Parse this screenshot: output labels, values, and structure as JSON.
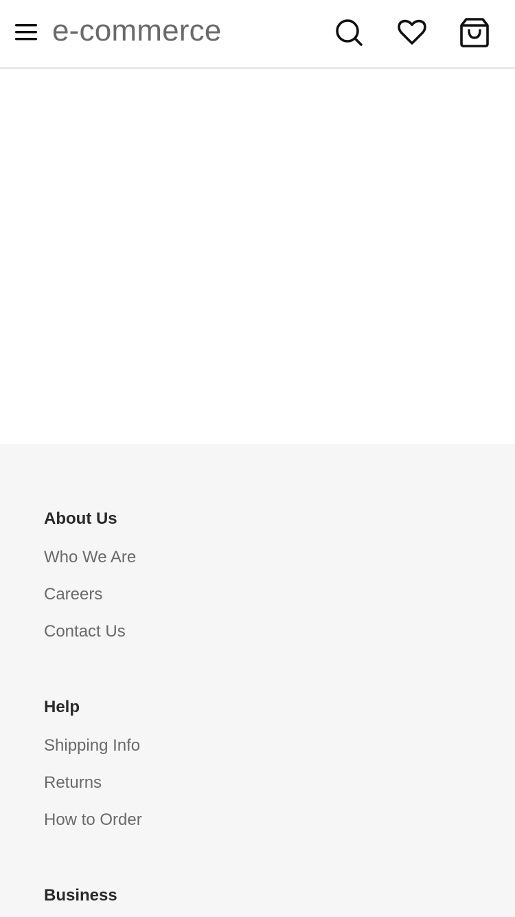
{
  "header": {
    "brand": "e-commerce",
    "icons": {
      "menu": "hamburger-menu-icon",
      "search": "search-icon",
      "wishlist": "heart-icon",
      "cart": "shopping-bag-icon"
    }
  },
  "footer": {
    "sections": [
      {
        "title": "About Us",
        "links": [
          "Who We Are",
          "Careers",
          "Contact Us"
        ]
      },
      {
        "title": "Help",
        "links": [
          "Shipping Info",
          "Returns",
          "How to Order"
        ]
      },
      {
        "title": "Business",
        "links": []
      }
    ]
  },
  "colors": {
    "header_bg": "#ffffff",
    "footer_bg": "#f6f6f6",
    "brand_text": "#6a6a6a",
    "heading_text": "#2a2a2a",
    "link_text": "#6a6a6a"
  }
}
